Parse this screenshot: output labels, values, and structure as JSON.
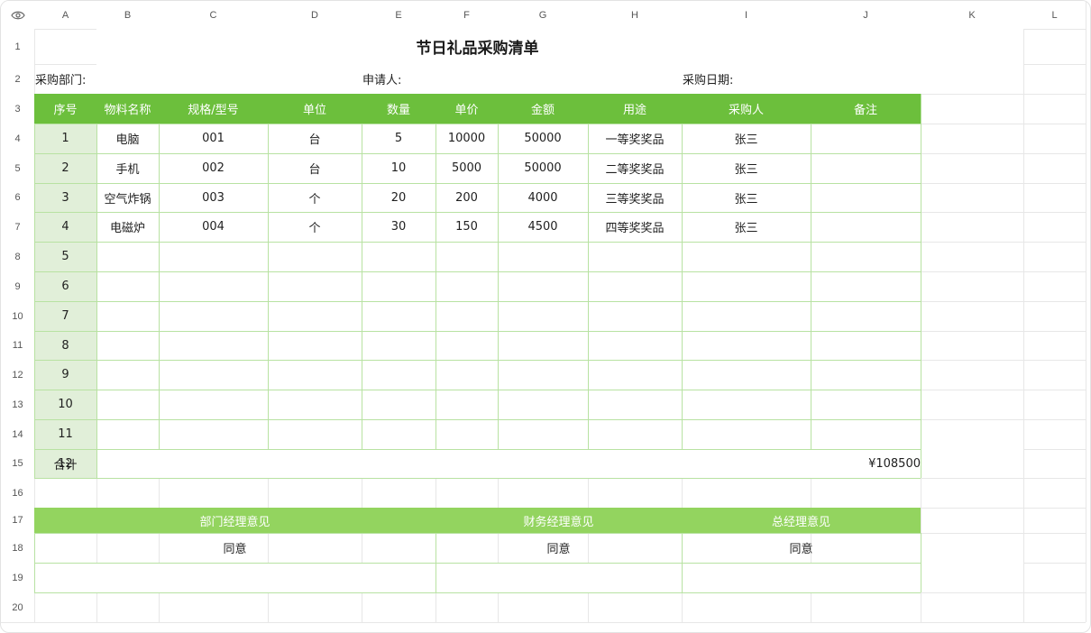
{
  "columns": [
    "A",
    "B",
    "C",
    "D",
    "E",
    "F",
    "G",
    "H",
    "I",
    "J",
    "K",
    "L"
  ],
  "rows": [
    "1",
    "2",
    "3",
    "4",
    "5",
    "6",
    "7",
    "8",
    "9",
    "10",
    "11",
    "12",
    "13",
    "14",
    "15",
    "16",
    "17",
    "18",
    "19",
    "20"
  ],
  "title": "节日礼品采购清单",
  "labels": {
    "dept": "采购部门:",
    "applicant": "申请人:",
    "date": "采购日期:"
  },
  "table_headers": [
    "序号",
    "物料名称",
    "规格/型号",
    "单位",
    "数量",
    "单价",
    "金额",
    "用途",
    "采购人",
    "备注"
  ],
  "items": [
    {
      "no": "1",
      "name": "电脑",
      "spec": "001",
      "unit": "台",
      "qty": "5",
      "price": "10000",
      "amount": "50000",
      "use": "一等奖奖品",
      "buyer": "张三",
      "note": ""
    },
    {
      "no": "2",
      "name": "手机",
      "spec": "002",
      "unit": "台",
      "qty": "10",
      "price": "5000",
      "amount": "50000",
      "use": "二等奖奖品",
      "buyer": "张三",
      "note": ""
    },
    {
      "no": "3",
      "name": "空气炸锅",
      "spec": "003",
      "unit": "个",
      "qty": "20",
      "price": "200",
      "amount": "4000",
      "use": "三等奖奖品",
      "buyer": "张三",
      "note": ""
    },
    {
      "no": "4",
      "name": "电磁炉",
      "spec": "004",
      "unit": "个",
      "qty": "30",
      "price": "150",
      "amount": "4500",
      "use": "四等奖奖品",
      "buyer": "张三",
      "note": ""
    }
  ],
  "empty_seq": [
    "5",
    "6",
    "7",
    "8",
    "9",
    "10",
    "11",
    "12"
  ],
  "total": {
    "label": "合计",
    "value": "¥108500"
  },
  "approvals": [
    {
      "title": "部门经理意见",
      "value": "同意"
    },
    {
      "title": "财务经理意见",
      "value": "同意"
    },
    {
      "title": "总经理意见",
      "value": "同意"
    }
  ],
  "colors": {
    "header_green": "#6cbf3c",
    "approval_green": "#93d45f",
    "seq_bg": "#e1efd9",
    "border_green": "#b8e2a2"
  },
  "icons": {
    "corner": "eye-icon"
  }
}
